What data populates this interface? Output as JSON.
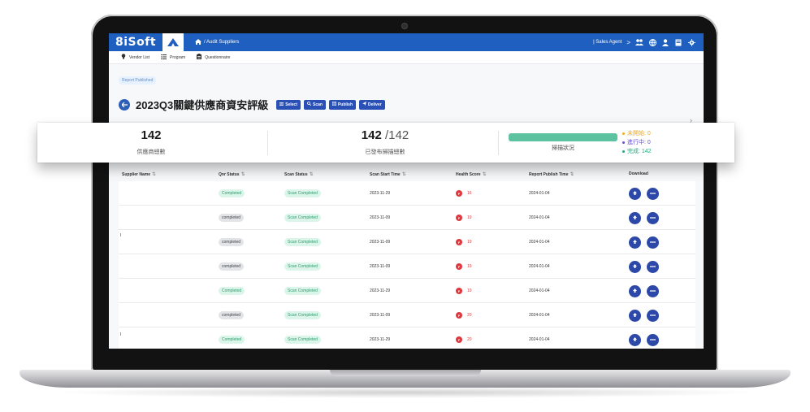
{
  "app": {
    "logo_text": "8iSoft",
    "breadcrumb": "/ Audit Suppliers",
    "role": "| Sales Agent",
    "role_chevron": ">"
  },
  "subnav": {
    "items": [
      {
        "label": "Vendor List",
        "icon": "bulb-icon"
      },
      {
        "label": "Program",
        "icon": "list-icon"
      },
      {
        "label": "Questionnaire",
        "icon": "clipboard-icon"
      }
    ]
  },
  "header": {
    "status_chip": "Report Published",
    "title": "2023Q3關鍵供應商資安評級",
    "buttons": {
      "select": "Select",
      "scan": "Scan",
      "publish": "Publish",
      "deliver": "Deliver"
    }
  },
  "summary": {
    "supplier_total": "142",
    "supplier_label": "供應商總數",
    "published_count": "142",
    "published_of": "/142",
    "published_label": "已發布掃描總數",
    "scan_status_label": "掃描狀況",
    "scan_progress": 1.0,
    "legend": {
      "not_started": "未開始: 0",
      "in_progress": "進行中: 0",
      "completed": "完成: 142"
    },
    "colors": {
      "not_started": "#f0a818",
      "in_progress": "#6a4fd6",
      "completed": "#2aa57a"
    }
  },
  "table": {
    "columns": [
      "Supplier Name",
      "Qnr Status",
      "Scan Status",
      "Scan Start Time",
      "Health Score",
      "Report Publish Time",
      "Download"
    ],
    "rows": [
      {
        "qnr": "Completed",
        "qnr_style": "green",
        "scan": "Scan Completed",
        "start": "2023-11-29",
        "grade": "F",
        "score": "16",
        "publish": "2024-01-04"
      },
      {
        "qnr": "completed",
        "qnr_style": "gray",
        "scan": "Scan Completed",
        "start": "2023-11-09",
        "grade": "F",
        "score": "19",
        "publish": "2024-01-04"
      },
      {
        "qnr": "completed",
        "qnr_style": "gray",
        "scan": "Scan Completed",
        "start": "2023-11-09",
        "grade": "F",
        "score": "19",
        "publish": "2024-01-04"
      },
      {
        "qnr": "completed",
        "qnr_style": "gray",
        "scan": "Scan Completed",
        "start": "2023-11-09",
        "grade": "F",
        "score": "19",
        "publish": "2024-01-04"
      },
      {
        "qnr": "Completed",
        "qnr_style": "green",
        "scan": "Scan Completed",
        "start": "2023-11-29",
        "grade": "F",
        "score": "19",
        "publish": "2024-01-04"
      },
      {
        "qnr": "completed",
        "qnr_style": "gray",
        "scan": "Scan Completed",
        "start": "2023-11-09",
        "grade": "F",
        "score": "20",
        "publish": "2024-01-04"
      },
      {
        "qnr": "Completed",
        "qnr_style": "green",
        "scan": "Scan Completed",
        "start": "2023-11-29",
        "grade": "F",
        "score": "20",
        "publish": "2024-01-04"
      }
    ]
  },
  "colors": {
    "brand_blue": "#1f5fbf",
    "button_blue": "#2a4fb5",
    "danger": "#e0383e",
    "success_bar": "#5cc2a0"
  }
}
